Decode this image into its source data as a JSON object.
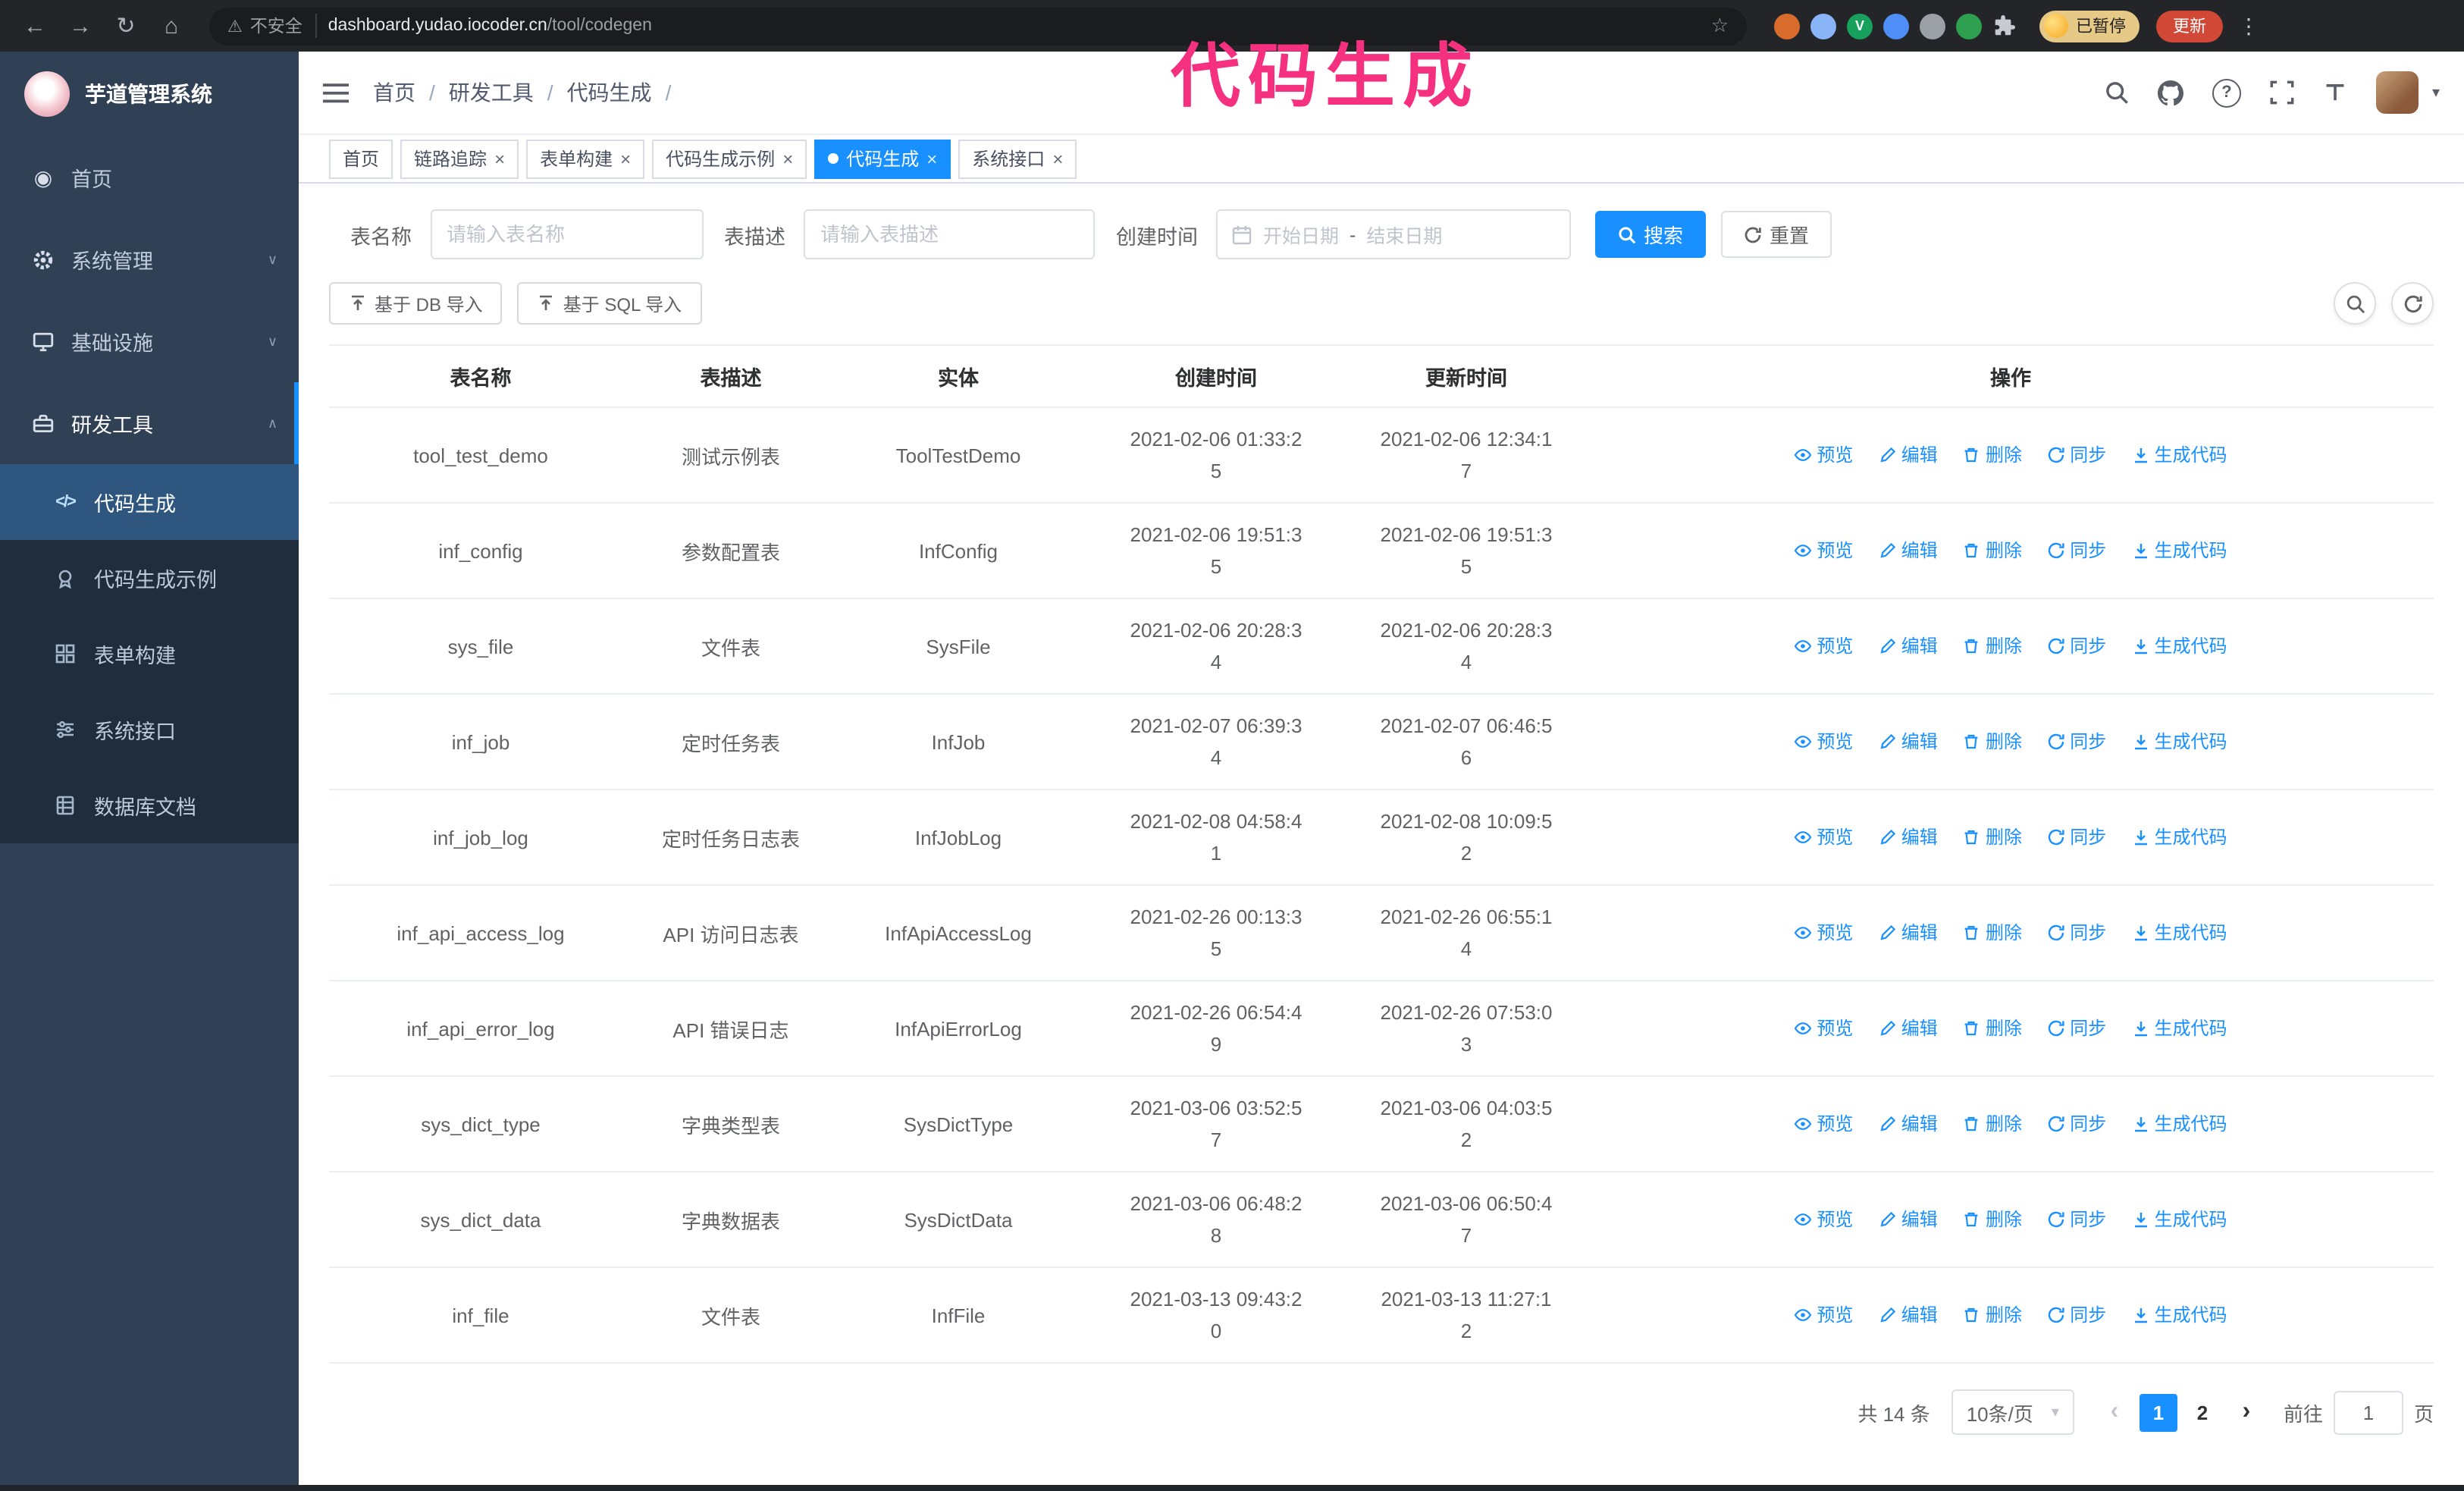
{
  "annotation": {
    "text": "代码生成",
    "color": "#f5317f"
  },
  "browser": {
    "warning_text": "不安全",
    "url_host": "dashboard.yudao.iocoder.cn",
    "url_path": "/tool/codegen",
    "paused_badge": "已暂停",
    "update_button": "更新",
    "extensions": [
      {
        "name": "extension-1",
        "color": "#d96c2c",
        "glyph": ""
      },
      {
        "name": "extension-2",
        "color": "#8ab4f8",
        "glyph": ""
      },
      {
        "name": "extension-3",
        "color": "#17a15c",
        "glyph": "V"
      },
      {
        "name": "extension-4",
        "color": "#4f8df7",
        "glyph": ""
      },
      {
        "name": "extension-5",
        "color": "#9aa0a6",
        "glyph": ""
      },
      {
        "name": "extension-6",
        "color": "#2e9e4f",
        "glyph": ""
      }
    ]
  },
  "icons": {
    "back": "←",
    "forward": "→",
    "reload": "↻",
    "home": "⌂",
    "warning": "⚠",
    "star": "☆",
    "kebab": "⋮",
    "question": "?",
    "caret_down": "▾",
    "close": "×",
    "prev": "‹",
    "next": "›",
    "chevron_collapsed": "∨",
    "chevron_expanded": "∧",
    "code": "</>"
  },
  "sidebar": {
    "logo_text": "芋道管理系统",
    "menu": [
      {
        "label": "首页",
        "icon": "home-icon"
      },
      {
        "label": "系统管理",
        "icon": "gear-icon"
      },
      {
        "label": "基础设施",
        "icon": "infrastructure-icon"
      },
      {
        "label": "研发工具",
        "icon": "dev-tools-icon"
      }
    ],
    "submenu": [
      {
        "label": "代码生成",
        "icon": "code-icon",
        "active": true
      },
      {
        "label": "代码生成示例",
        "icon": "badge-icon"
      },
      {
        "label": "表单构建",
        "icon": "form-icon"
      },
      {
        "label": "系统接口",
        "icon": "api-icon"
      },
      {
        "label": "数据库文档",
        "icon": "database-icon"
      }
    ]
  },
  "header": {
    "breadcrumb": [
      {
        "label": "首页"
      },
      {
        "label": "研发工具"
      },
      {
        "label": "代码生成"
      }
    ]
  },
  "tabbar": {
    "tabs": [
      {
        "label": "首页",
        "affix": true
      },
      {
        "label": "链路追踪"
      },
      {
        "label": "表单构建"
      },
      {
        "label": "代码生成示例"
      },
      {
        "label": "代码生成",
        "active": true
      },
      {
        "label": "系统接口"
      }
    ]
  },
  "filters": {
    "table_name_label": "表名称",
    "table_name_placeholder": "请输入表名称",
    "table_desc_label": "表描述",
    "table_desc_placeholder": "请输入表描述",
    "create_time_label": "创建时间",
    "date_start_placeholder": "开始日期",
    "date_separator": "-",
    "date_end_placeholder": "结束日期",
    "search_label": "搜索",
    "reset_label": "重置"
  },
  "toolbar": {
    "import_db_label": "基于 DB 导入",
    "import_sql_label": "基于 SQL 导入"
  },
  "table": {
    "columns": [
      "表名称",
      "表描述",
      "实体",
      "创建时间",
      "更新时间",
      "操作"
    ],
    "actions": [
      {
        "label": "预览",
        "icon": "eye-icon"
      },
      {
        "label": "编辑",
        "icon": "edit-icon"
      },
      {
        "label": "删除",
        "icon": "delete-icon"
      },
      {
        "label": "同步",
        "icon": "sync-icon"
      },
      {
        "label": "生成代码",
        "icon": "download-icon"
      }
    ],
    "rows": [
      {
        "name": "tool_test_demo",
        "desc": "测试示例表",
        "entity": "ToolTestDemo",
        "created": "2021-02-06 01:33:25",
        "updated": "2021-02-06 12:34:17"
      },
      {
        "name": "inf_config",
        "desc": "参数配置表",
        "entity": "InfConfig",
        "created": "2021-02-06 19:51:35",
        "updated": "2021-02-06 19:51:35"
      },
      {
        "name": "sys_file",
        "desc": "文件表",
        "entity": "SysFile",
        "created": "2021-02-06 20:28:34",
        "updated": "2021-02-06 20:28:34"
      },
      {
        "name": "inf_job",
        "desc": "定时任务表",
        "entity": "InfJob",
        "created": "2021-02-07 06:39:34",
        "updated": "2021-02-07 06:46:56"
      },
      {
        "name": "inf_job_log",
        "desc": "定时任务日志表",
        "entity": "InfJobLog",
        "created": "2021-02-08 04:58:41",
        "updated": "2021-02-08 10:09:52"
      },
      {
        "name": "inf_api_access_log",
        "desc": "API 访问日志表",
        "entity": "InfApiAccessLog",
        "created": "2021-02-26 00:13:35",
        "updated": "2021-02-26 06:55:14"
      },
      {
        "name": "inf_api_error_log",
        "desc": "API 错误日志",
        "entity": "InfApiErrorLog",
        "created": "2021-02-26 06:54:49",
        "updated": "2021-02-26 07:53:03"
      },
      {
        "name": "sys_dict_type",
        "desc": "字典类型表",
        "entity": "SysDictType",
        "created": "2021-03-06 03:52:57",
        "updated": "2021-03-06 04:03:52"
      },
      {
        "name": "sys_dict_data",
        "desc": "字典数据表",
        "entity": "SysDictData",
        "created": "2021-03-06 06:48:28",
        "updated": "2021-03-06 06:50:47"
      },
      {
        "name": "inf_file",
        "desc": "文件表",
        "entity": "InfFile",
        "created": "2021-03-13 09:43:20",
        "updated": "2021-03-13 11:27:12"
      }
    ]
  },
  "pagination": {
    "total_text": "共 14 条",
    "page_size_text": "10条/页",
    "pages": [
      {
        "num": "1",
        "active": true
      },
      {
        "num": "2"
      }
    ],
    "goto_label": "前往",
    "goto_value": "1",
    "unit_label": "页"
  }
}
